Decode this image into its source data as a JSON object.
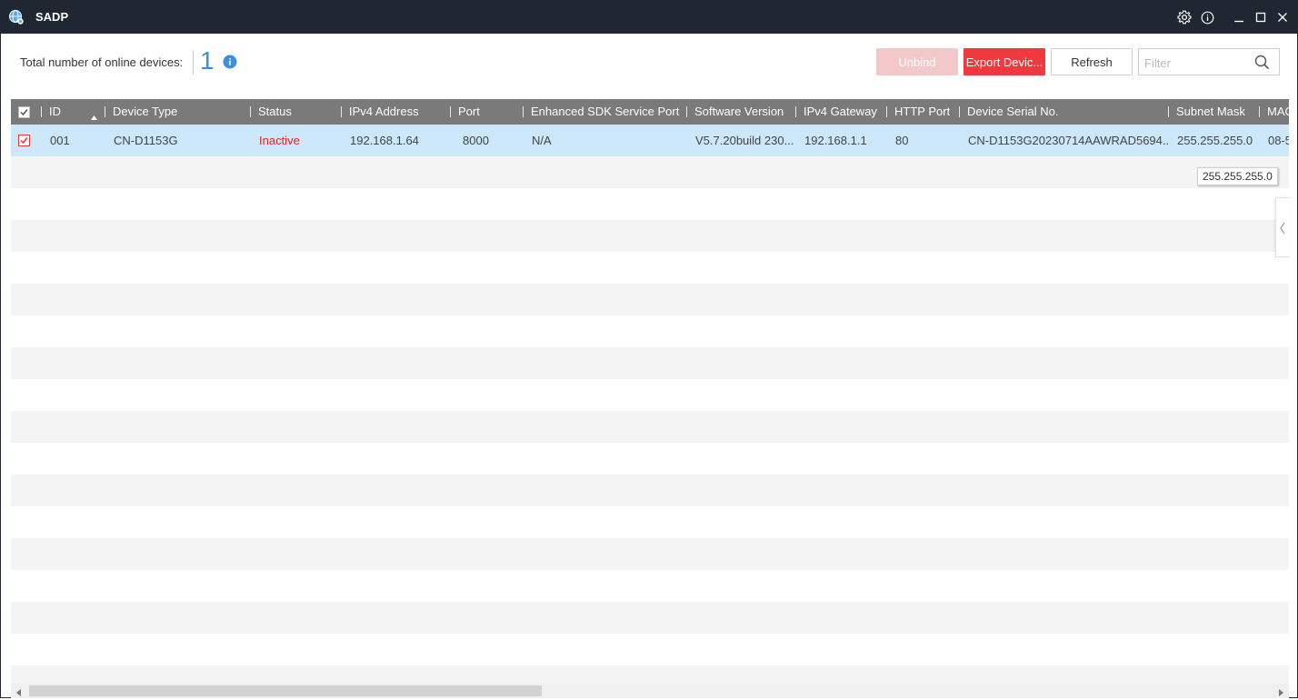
{
  "app": {
    "title": "SADP"
  },
  "titlebar": {
    "icons": [
      "gear-icon",
      "info-icon",
      "minimize-icon",
      "maximize-icon",
      "close-icon"
    ]
  },
  "toolbar": {
    "online_label": "Total number of online devices:",
    "online_count": "1",
    "unbind_label": "Unbind",
    "export_label": "Export Devic...",
    "refresh_label": "Refresh",
    "filter_placeholder": "Filter"
  },
  "colors": {
    "titlebar": "#1f2733",
    "accent_blue": "#3b8fe0",
    "export_red": "#f0393f",
    "unbind_disabled": "#f2c8ca",
    "selected_row": "#cde8fb",
    "header_gray": "#7a7a7a",
    "inactive_red": "#e02424"
  },
  "table": {
    "columns": [
      "ID",
      "Device Type",
      "Status",
      "IPv4 Address",
      "Port",
      "Enhanced SDK Service Port",
      "Software Version",
      "IPv4 Gateway",
      "HTTP Port",
      "Device Serial No.",
      "Subnet Mask",
      "MAC"
    ],
    "visible_columns": [
      "ID",
      "Device Type",
      "Status",
      "IPv4 Address",
      "Port",
      "Enhanced SDK Service Port",
      "Software Version",
      "IPv4 Gateway",
      "HTTP Port",
      "Device Serial No.",
      "Subnet Mask",
      "MAC"
    ],
    "sort_column": "ID",
    "sort_direction": "ascending",
    "rows": [
      {
        "checked": true,
        "id": "001",
        "device_type": "CN-D1153G",
        "status": "Inactive",
        "ipv4": "192.168.1.64",
        "port": "8000",
        "sdk_port": "N/A",
        "software_version": "V5.7.20build 230...",
        "gateway": "192.168.1.1",
        "http_port": "80",
        "serial": "CN-D1153G20230714AAWRAD5694...",
        "subnet_mask": "255.255.255.0",
        "mac": "08-5"
      }
    ]
  },
  "tooltip": {
    "text": "255.255.255.0"
  }
}
